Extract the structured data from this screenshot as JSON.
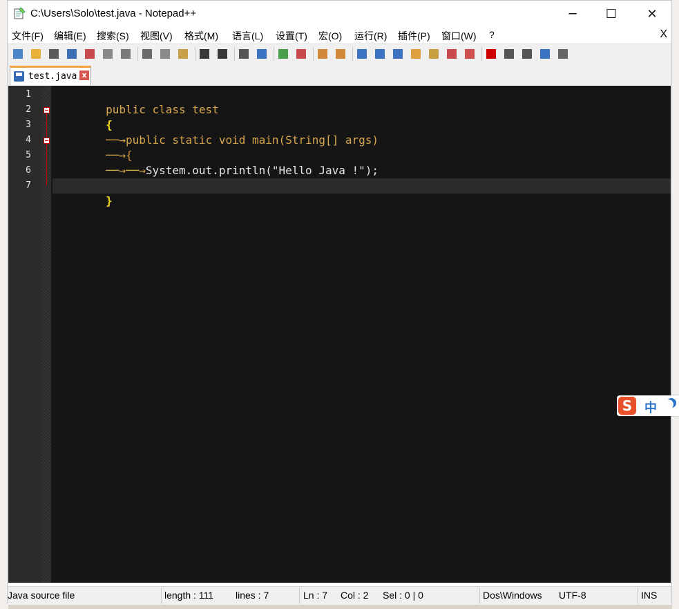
{
  "window": {
    "title": "C:\\Users\\Solo\\test.java - Notepad++",
    "controls": {
      "minimize": "─",
      "maximize": "☐",
      "close": "✕"
    }
  },
  "menu": {
    "items": [
      "文件(F)",
      "编辑(E)",
      "搜索(S)",
      "视图(V)",
      "格式(M)",
      "语言(L)",
      "设置(T)",
      "宏(O)",
      "运行(R)",
      "插件(P)",
      "窗口(W)",
      "?"
    ],
    "close_label": "X"
  },
  "toolbar": {
    "icons": [
      "new-file-icon",
      "open-file-icon",
      "save-icon",
      "save-all-icon",
      "close-icon",
      "close-all-icon",
      "print-icon",
      "cut-icon",
      "copy-icon",
      "paste-icon",
      "undo-icon",
      "redo-icon",
      "find-icon",
      "replace-icon",
      "zoom-in-icon",
      "zoom-out-icon",
      "sync-vertical-icon",
      "sync-horizontal-icon",
      "word-wrap-icon",
      "show-all-chars-icon",
      "indent-guide-icon",
      "user-language-icon",
      "doc-map-icon",
      "function-list-icon",
      "folder-workspace-icon",
      "record-macro-icon",
      "stop-record-icon",
      "play-macro-icon",
      "run-macro-multiple-icon",
      "save-macro-icon"
    ]
  },
  "tab": {
    "label": "test.java",
    "close": "x"
  },
  "editor": {
    "line_numbers": [
      "1",
      "2",
      "3",
      "4",
      "5",
      "6",
      "7"
    ],
    "lines": [
      "public class test",
      "{",
      "public static void main(String[] args)",
      "{",
      "System.out.println(\"Hello Java !\");",
      "}",
      "}"
    ],
    "current_line": 7
  },
  "status": {
    "file_type": "Java source file",
    "length": "length : 111",
    "lines": "lines : 7",
    "ln": "Ln : 7",
    "col": "Col : 2",
    "sel": "Sel : 0 | 0",
    "eol": "Dos\\Windows",
    "encoding": "UTF-8",
    "mode": "INS"
  },
  "ime": {
    "logo": "S",
    "mode": "中"
  },
  "colors": {
    "keyword": "#d9a84e",
    "identifier": "#e6e6e6",
    "brace": "#f5d623",
    "string": "#b8a77e",
    "editor_bg": "#151515",
    "tab_accent": "#f4a142"
  }
}
